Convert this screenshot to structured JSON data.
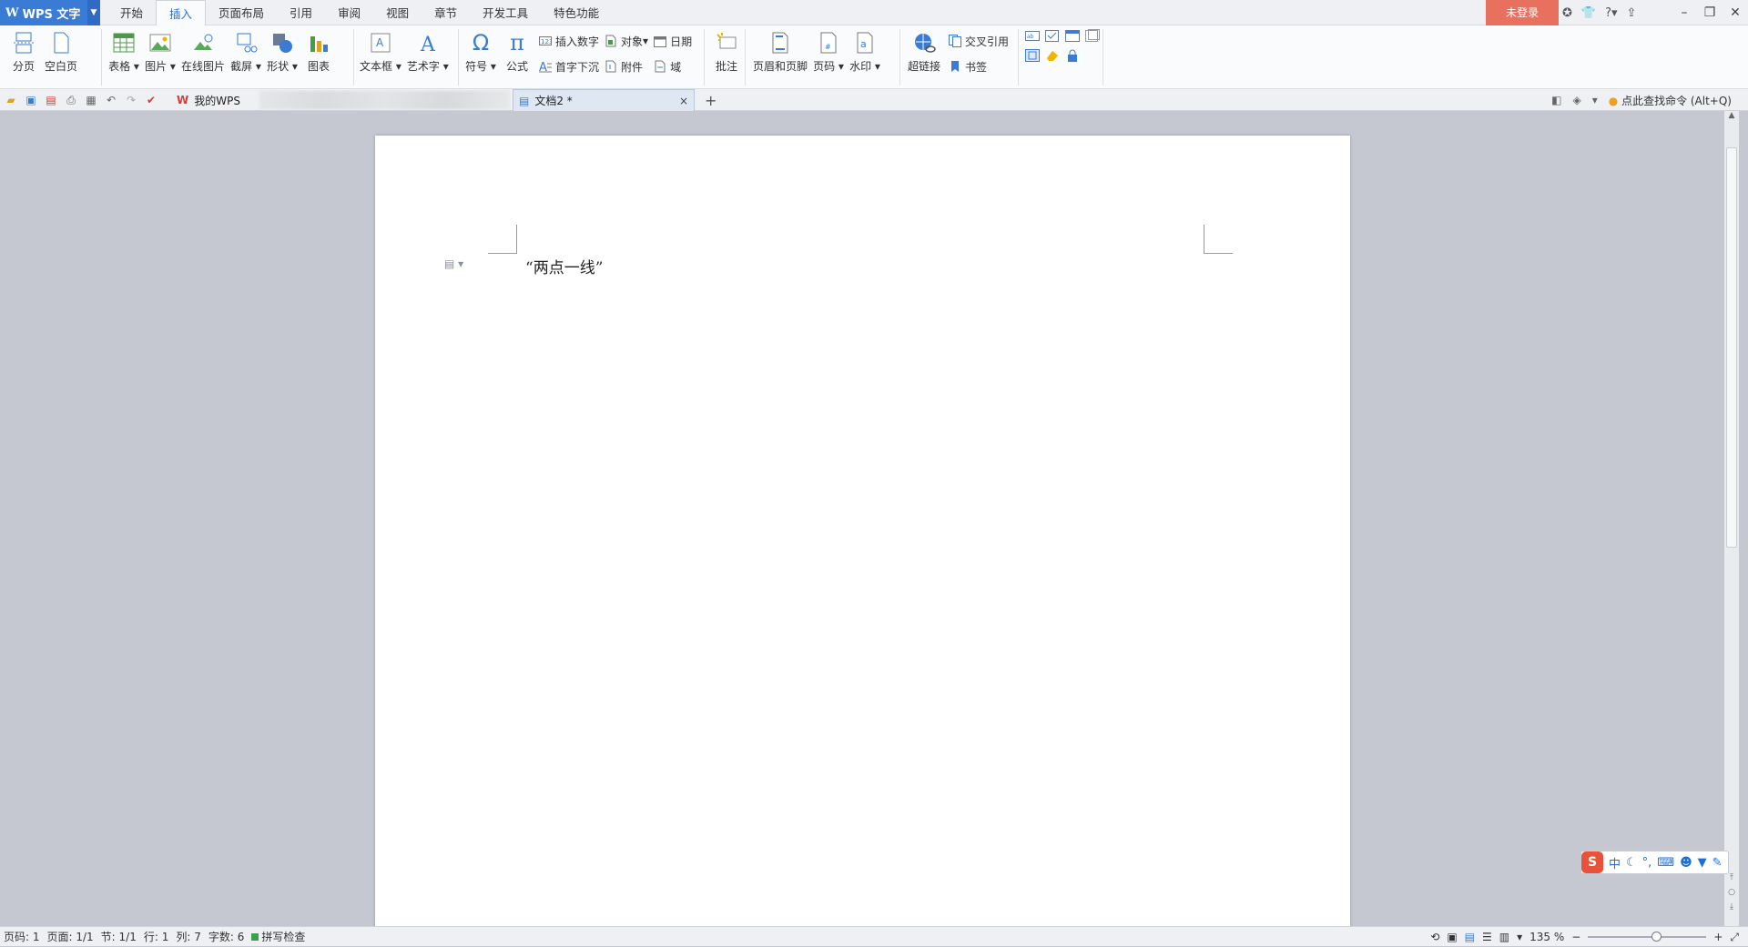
{
  "app": {
    "name": "WPS 文字",
    "login": "未登录"
  },
  "menu_tabs": [
    "开始",
    "插入",
    "页面布局",
    "引用",
    "审阅",
    "视图",
    "章节",
    "开发工具",
    "特色功能"
  ],
  "active_tab": "插入",
  "ribbon": {
    "page_break": "分页",
    "blank_page": "空白页",
    "table": "表格",
    "picture": "图片",
    "online_picture": "在线图片",
    "screenshot": "截屏",
    "shape": "形状",
    "chart": "图表",
    "textbox": "文本框",
    "wordart": "艺术字",
    "symbol": "符号",
    "equation": "公式",
    "insert_number": "插入数字",
    "drop_cap": "首字下沉",
    "object": "对象",
    "attachment": "附件",
    "date": "日期",
    "field": "域",
    "comment": "批注",
    "header_footer": "页眉和页脚",
    "page_number": "页码",
    "watermark": "水印",
    "hyperlink": "超链接",
    "cross_reference": "交叉引用",
    "bookmark": "书签"
  },
  "tabs": {
    "my_wps": "我的WPS",
    "doc": "文档2 *",
    "command_search": "点此查找命令 (Alt+Q)"
  },
  "document": {
    "text": "“两点一线”"
  },
  "status": {
    "page_code": "页码: 1",
    "pages": "页面: 1/1",
    "section": "节: 1/1",
    "row": "行: 1",
    "column": "列: 7",
    "word_count": "字数: 6",
    "spell_check": "拼写检查",
    "zoom": "135 %"
  },
  "ime": {
    "mode": "中"
  },
  "colors": {
    "accent": "#3a7bd5",
    "login_bg": "#e8705e",
    "active_tab_text": "#2a6fd0"
  }
}
